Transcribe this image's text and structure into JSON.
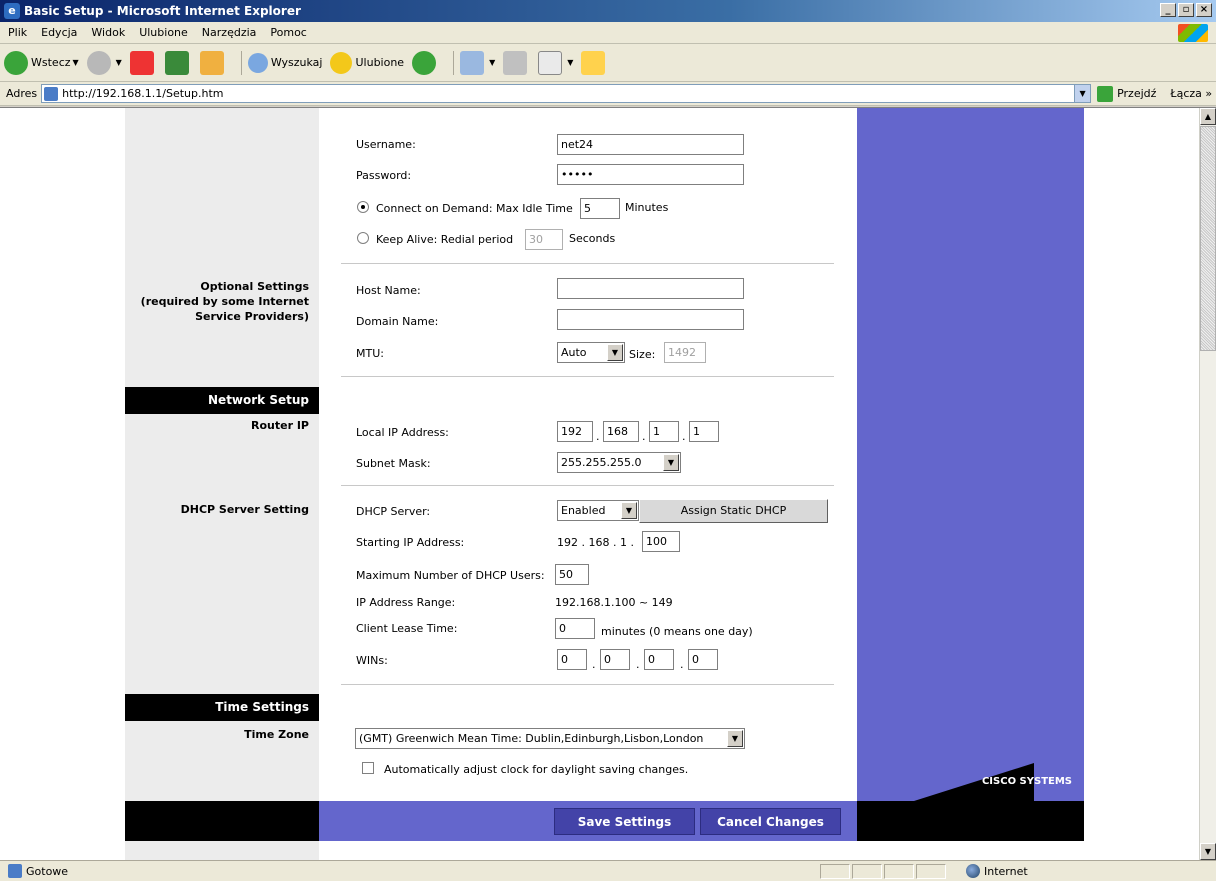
{
  "window": {
    "title": "Basic Setup - Microsoft Internet Explorer"
  },
  "menu": [
    "Plik",
    "Edycja",
    "Widok",
    "Ulubione",
    "Narzędzia",
    "Pomoc"
  ],
  "toolbar": {
    "back": "Wstecz",
    "search": "Wyszukaj",
    "favorites": "Ulubione"
  },
  "address": {
    "label": "Adres",
    "url": "http://192.168.1.1/Setup.htm",
    "go": "Przejdź",
    "links": "Łącza »"
  },
  "pppoe": {
    "username_label": "Username:",
    "username": "net24",
    "password_label": "Password:",
    "password": "•••••",
    "connect_on_demand": "Connect on Demand: Max Idle Time",
    "idle_time": "5",
    "minutes": "Minutes",
    "keep_alive": "Keep Alive: Redial period",
    "redial_period": "30",
    "seconds": "Seconds"
  },
  "optional": {
    "section_label": "Optional Settings\n(required by some Internet\nService Providers)",
    "host_name_label": "Host Name:",
    "host_name": "",
    "domain_name_label": "Domain Name:",
    "domain_name": "",
    "mtu_label": "MTU:",
    "mtu_mode": "Auto",
    "size_label": "Size:",
    "mtu_size": "1492"
  },
  "network": {
    "header": "Network Setup",
    "router_ip_label": "Router IP",
    "local_ip_label": "Local IP Address:",
    "local_ip": [
      "192",
      "168",
      "1",
      "1"
    ],
    "subnet_label": "Subnet Mask:",
    "subnet": "255.255.255.0"
  },
  "dhcp": {
    "section_label": "DHCP Server Setting",
    "server_label": "DHCP Server:",
    "server": "Enabled",
    "assign_static": "Assign Static DHCP",
    "start_ip_label": "Starting IP Address:",
    "start_ip_prefix": "192 . 168 . 1 .",
    "start_ip_last": "100",
    "max_users_label": "Maximum Number of DHCP Users:",
    "max_users": "50",
    "range_label": "IP Address Range:",
    "range": "192.168.1.100 ~ 149",
    "lease_label": "Client Lease Time:",
    "lease": "0",
    "lease_note": "minutes (0 means one day)",
    "wins_label": "WINs:",
    "wins": [
      "0",
      "0",
      "0",
      "0"
    ]
  },
  "time": {
    "header": "Time Settings",
    "zone_label": "Time Zone",
    "zone": "(GMT) Greenwich Mean Time: Dublin,Edinburgh,Lisbon,London",
    "dst": "Automatically adjust clock for daylight saving changes."
  },
  "actions": {
    "save": "Save Settings",
    "cancel": "Cancel Changes"
  },
  "brand": {
    "name": "CISCO SYSTEMS"
  },
  "status": {
    "text": "Gotowe",
    "zone": "Internet"
  },
  "colors": {
    "purple": "#6466cc",
    "titlebar": "#0a246a"
  }
}
